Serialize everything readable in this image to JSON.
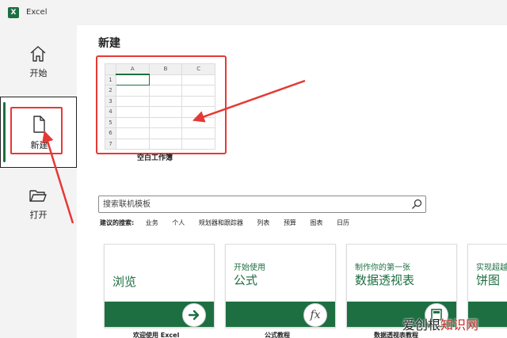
{
  "app": {
    "title": "Excel",
    "logo_letter": "X"
  },
  "sidebar": {
    "items": [
      {
        "label": "开始",
        "icon": "home-icon"
      },
      {
        "label": "新建",
        "icon": "new-document-icon",
        "selected": true
      },
      {
        "label": "打开",
        "icon": "open-folder-icon"
      }
    ]
  },
  "new_section": {
    "title": "新建",
    "blank_workbook": {
      "caption": "空白工作簿",
      "columns": [
        "A",
        "B",
        "C"
      ],
      "rows": [
        "1",
        "2",
        "3",
        "4",
        "5",
        "6",
        "7"
      ]
    }
  },
  "search": {
    "placeholder": "搜索联机模板",
    "suggested_label": "建议的搜索:",
    "suggested": [
      "业务",
      "个人",
      "规划器和跟踪器",
      "列表",
      "预算",
      "图表",
      "日历"
    ]
  },
  "templates": [
    {
      "small": "",
      "big": "浏览",
      "caption": "欢迎使用 Excel",
      "icon": "arrow-right-icon"
    },
    {
      "small": "开始使用",
      "big": "公式",
      "caption": "公式教程",
      "icon": "fx-icon"
    },
    {
      "small": "制作你的第一张",
      "big": "数据透视表",
      "caption": "数据透视表教程",
      "icon": "pivot-icon"
    },
    {
      "small": "实现超越",
      "big": "饼图",
      "caption": "",
      "icon": ""
    }
  ],
  "watermark": {
    "part1": "爱创根",
    "part2": "知识网"
  },
  "colors": {
    "accent": "#1d6f42",
    "annotation": "#e53935",
    "sidebar_bg": "#f3f3f3"
  }
}
